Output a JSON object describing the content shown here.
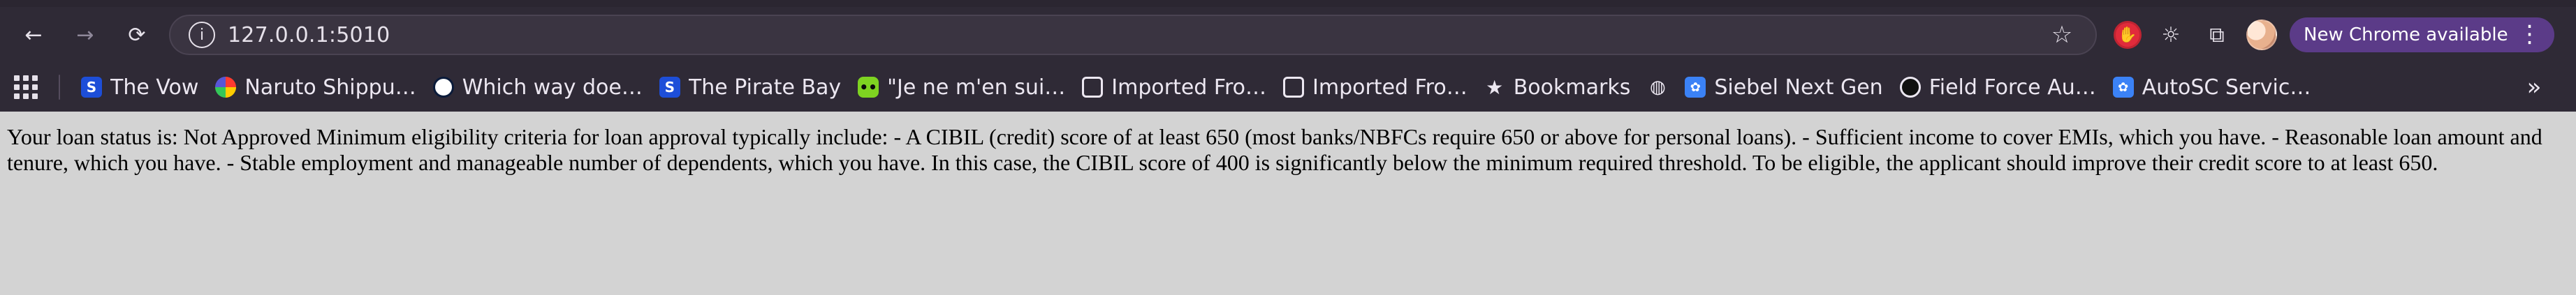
{
  "browser": {
    "address_bar": {
      "url": "127.0.0.1:5010"
    },
    "update_button": {
      "label": "New Chrome available"
    },
    "bookmarks": [
      {
        "label": "The Vow",
        "icon": "s-badge-icon"
      },
      {
        "label": "Naruto Shippu…",
        "icon": "pinwheel-icon"
      },
      {
        "label": "Which way doe…",
        "icon": "round-logo-icon"
      },
      {
        "label": "The Pirate Bay",
        "icon": "s-badge-icon"
      },
      {
        "label": "\"Je ne m'en sui…",
        "icon": "green-face-icon"
      },
      {
        "label": "Imported Fro…",
        "icon": "folder-icon"
      },
      {
        "label": "Imported Fro…",
        "icon": "folder-icon"
      },
      {
        "label": "Bookmarks",
        "icon": "star-icon"
      },
      {
        "label": "",
        "icon": "globe-icon"
      },
      {
        "label": "Siebel Next Gen",
        "icon": "blue-gear-icon"
      },
      {
        "label": "Field Force Au…",
        "icon": "black-circle-icon"
      },
      {
        "label": "AutoSC Servic…",
        "icon": "blue-gear-icon"
      }
    ]
  },
  "page": {
    "body_text": "Your loan status is: Not Approved Minimum eligibility criteria for loan approval typically include: - A CIBIL (credit) score of at least 650 (most banks/NBFCs require 650 or above for personal loans). - Sufficient income to cover EMIs, which you have. - Reasonable loan amount and tenure, which you have. - Stable employment and manageable number of dependents, which you have. In this case, the CIBIL score of 400 is significantly below the minimum required threshold. To be eligible, the applicant should improve their credit score to at least 650."
  },
  "colors": {
    "page_background": "#d3d3d3",
    "chrome_dark": "#2f2a36",
    "update_pill": "#5b3b88"
  }
}
